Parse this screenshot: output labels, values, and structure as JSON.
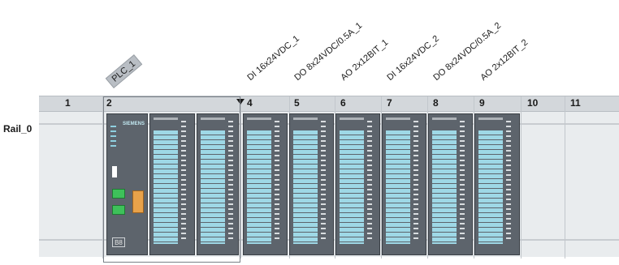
{
  "plc_label": "PLC_1",
  "rail_label": "Rail_0",
  "slot_numbers": [
    "1",
    "2",
    "4",
    "5",
    "6",
    "7",
    "8",
    "9",
    "10",
    "11"
  ],
  "modules": [
    {
      "label": "DI 16x24VDC_1"
    },
    {
      "label": "DO 8x24VDC/0.5A_1"
    },
    {
      "label": "AO 2x12BIT_1"
    },
    {
      "label": "DI 16x24VDC_2"
    },
    {
      "label": "DO 8x24VDC/0.5A_2"
    },
    {
      "label": "AO 2x12BIT_2"
    }
  ],
  "cpu": {
    "brand": "SIEMENS",
    "display": "B8"
  },
  "colors": {
    "module_body": "#5d646c",
    "channel_strip": "#9ed8e6",
    "header": "#d3d7db"
  }
}
